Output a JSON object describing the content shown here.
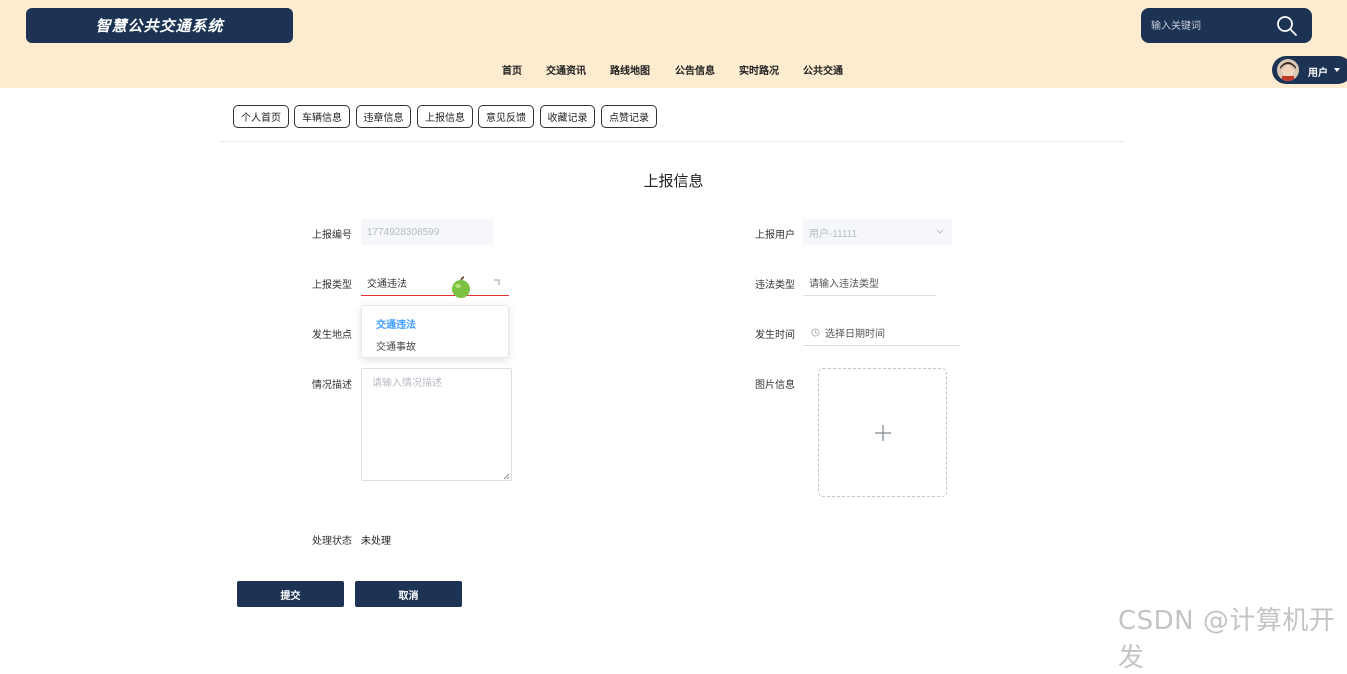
{
  "header": {
    "logo_title": "智慧公共交通系统",
    "search_placeholder": "输入关键词",
    "nav": [
      "首页",
      "交通资讯",
      "路线地图",
      "公告信息",
      "实时路况",
      "公共交通"
    ],
    "user_label": "用户"
  },
  "tabs": [
    "个人首页",
    "车辆信息",
    "违章信息",
    "上报信息",
    "意见反馈",
    "收藏记录",
    "点赞记录"
  ],
  "page_title": "上报信息",
  "form": {
    "report_no_label": "上报编号",
    "report_no_value": "1774928308599",
    "report_user_label": "上报用户",
    "report_user_value": "用户-11111",
    "report_type_label": "上报类型",
    "report_type_value": "交通违法",
    "violation_type_label": "违法类型",
    "violation_type_placeholder": "请输入违法类型",
    "location_label": "发生地点",
    "time_label": "发生时间",
    "time_placeholder": "选择日期时间",
    "desc_label": "情况描述",
    "desc_placeholder": "请输入情况描述",
    "image_label": "图片信息",
    "status_label": "处理状态",
    "status_value": "未处理",
    "dropdown_options": [
      "交通违法",
      "交通事故"
    ]
  },
  "buttons": {
    "submit": "提交",
    "cancel": "取消"
  },
  "watermark": "CSDN @计算机开发",
  "colors": {
    "header_bg": "#fdecd0",
    "primary": "#1c3354",
    "active_option": "#409eff",
    "focus_border": "#e03030"
  }
}
